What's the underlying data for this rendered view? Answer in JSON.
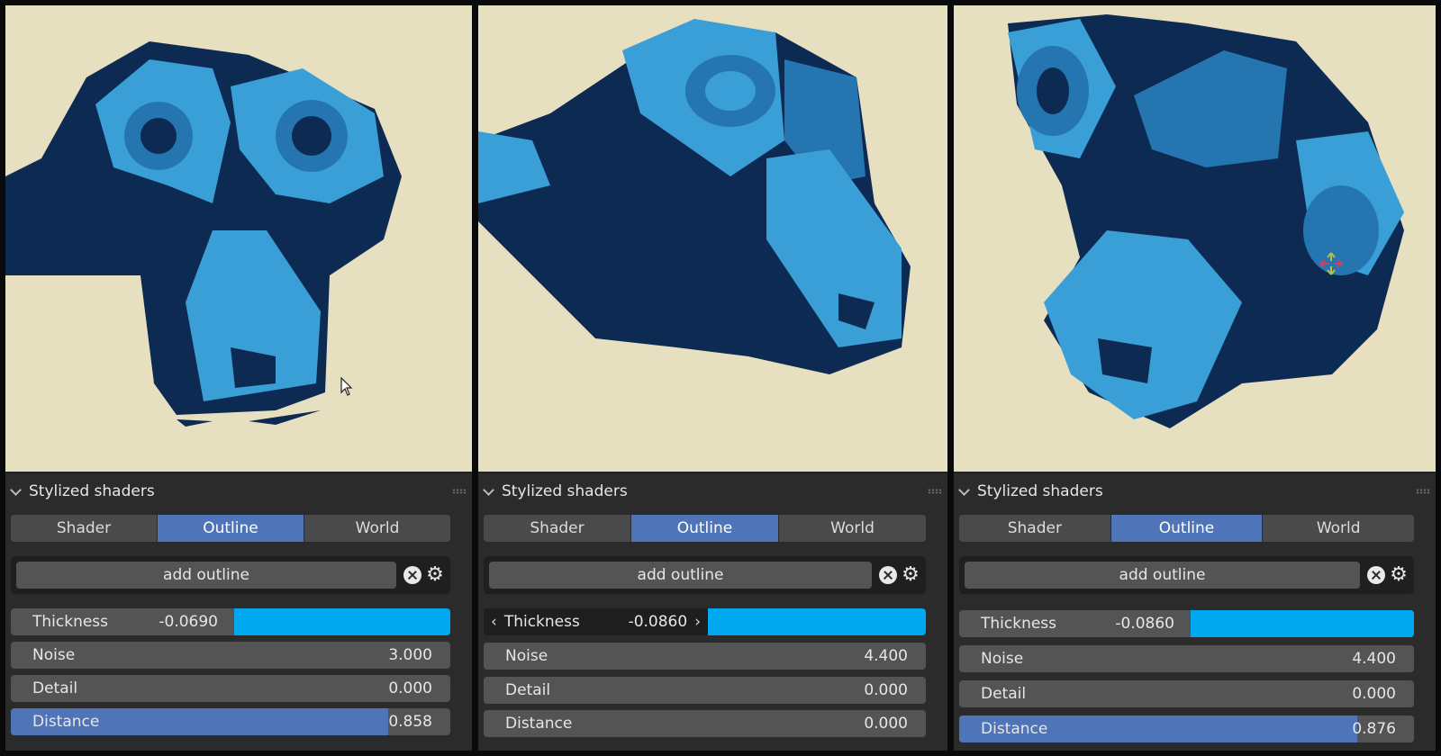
{
  "panes": [
    {
      "header": "Stylized shaders",
      "tabs": [
        "Shader",
        "Outline",
        "World"
      ],
      "active_tab": "Outline",
      "add_label": "add outline",
      "thickness": {
        "label": "Thickness",
        "value": "-0.0690"
      },
      "noise": {
        "label": "Noise",
        "value": "3.000"
      },
      "detail": {
        "label": "Detail",
        "value": "0.000"
      },
      "distance": {
        "label": "Distance",
        "value": "0.858",
        "fill": 0.858
      }
    },
    {
      "header": "Stylized shaders",
      "tabs": [
        "Shader",
        "Outline",
        "World"
      ],
      "active_tab": "Outline",
      "add_label": "add outline",
      "thickness": {
        "label": "Thickness",
        "value": "-0.0860",
        "editing": true
      },
      "noise": {
        "label": "Noise",
        "value": "4.400"
      },
      "detail": {
        "label": "Detail",
        "value": "0.000"
      },
      "distance": {
        "label": "Distance",
        "value": "0.000",
        "fill": 0
      }
    },
    {
      "header": "Stylized shaders",
      "tabs": [
        "Shader",
        "Outline",
        "World"
      ],
      "active_tab": "Outline",
      "add_label": "add outline",
      "thickness": {
        "label": "Thickness",
        "value": "-0.0860"
      },
      "noise": {
        "label": "Noise",
        "value": "4.400"
      },
      "detail": {
        "label": "Detail",
        "value": "0.000"
      },
      "distance": {
        "label": "Distance",
        "value": "0.876",
        "fill": 0.876
      }
    }
  ],
  "colors": {
    "viewport_bg": "#e6dfc0",
    "monkey_dark": "#0d2a52",
    "monkey_light": "#3a9fd6",
    "monkey_mid": "#2576b0",
    "accent_blue": "#4f74b8",
    "thickness_bar": "#00a8f0"
  },
  "icons": {
    "remove": "close-circle-icon",
    "settings": "gear-icon",
    "collapse": "chevron-down-icon"
  }
}
